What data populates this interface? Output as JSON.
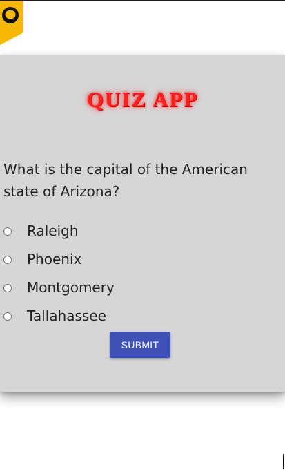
{
  "corner": {
    "icon": "github-icon",
    "colors": {
      "ribbon": "#f5b800",
      "octocat": "#111111"
    }
  },
  "quiz": {
    "title": "QUIZ APP",
    "question": "What is the capital of the American state of Arizona?",
    "options": [
      "Raleigh",
      "Phoenix",
      "Montgomery",
      "Tallahassee"
    ],
    "submit_label": "SUBMIT"
  },
  "colors": {
    "card_background": "#d6d6d6",
    "title": "#ff2020",
    "button": "#3f51b5",
    "text": "#222222"
  }
}
